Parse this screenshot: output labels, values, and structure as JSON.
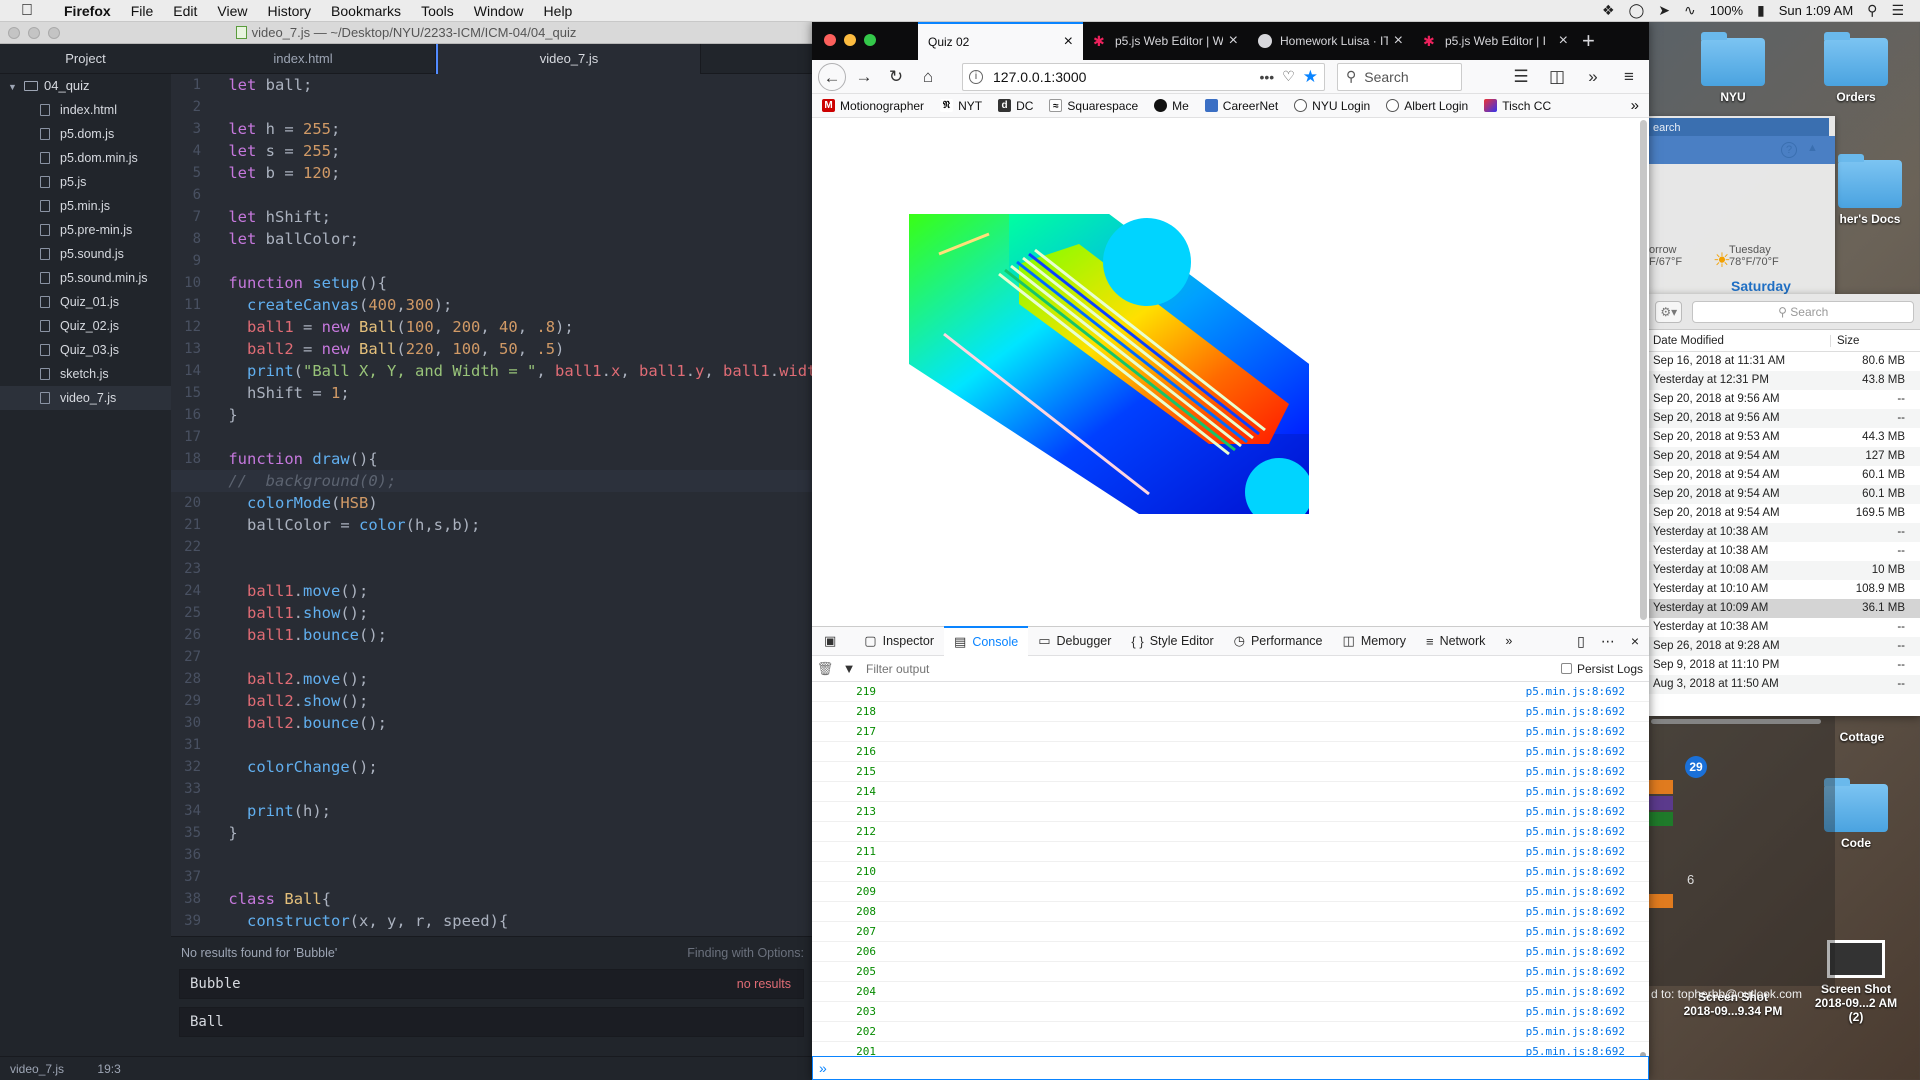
{
  "menubar": {
    "app": "Firefox",
    "items": [
      "File",
      "Edit",
      "View",
      "History",
      "Bookmarks",
      "Tools",
      "Window",
      "Help"
    ],
    "battery": "100%",
    "clock": "Sun 1:09 AM"
  },
  "editor": {
    "title": "video_7.js — ~/Desktop/NYU/2233-ICM/ICM-04/04_quiz",
    "tree_header": "Project",
    "folder": "04_quiz",
    "files": [
      "index.html",
      "p5.dom.js",
      "p5.dom.min.js",
      "p5.js",
      "p5.min.js",
      "p5.pre-min.js",
      "p5.sound.js",
      "p5.sound.min.js",
      "Quiz_01.js",
      "Quiz_02.js",
      "Quiz_03.js",
      "sketch.js",
      "video_7.js"
    ],
    "active_file_index": 12,
    "tabs": [
      "index.html",
      "video_7.js"
    ],
    "active_tab_index": 1,
    "current_line": 19,
    "find": {
      "message": "No results found for 'Bubble'",
      "options": "Finding with Options:",
      "find_value": "Bubble",
      "find_status": "no results",
      "replace_value": "Ball"
    },
    "status": {
      "file": "video_7.js",
      "cursor": "19:3"
    }
  },
  "firefox": {
    "tabs": [
      {
        "title": "Quiz 02",
        "icon": "page-icon"
      },
      {
        "title": "p5.js Web Editor | W",
        "icon": "p5-star-icon"
      },
      {
        "title": "Homework Luisa · IT",
        "icon": "github-icon"
      },
      {
        "title": "p5.js Web Editor | I",
        "icon": "p5-star-icon"
      }
    ],
    "active_tab_index": 0,
    "url": "127.0.0.1:3000",
    "search_placeholder": "Search",
    "bookmarks": [
      "Motionographer",
      "NYT",
      "DC",
      "Squarespace",
      "Me",
      "CareerNet",
      "NYU Login",
      "Albert Login",
      "Tisch CC"
    ],
    "devtools": {
      "tabs": [
        "Inspector",
        "Console",
        "Debugger",
        "Style Editor",
        "Performance",
        "Memory",
        "Network"
      ],
      "active_tab_index": 1,
      "filter_placeholder": "Filter output",
      "persist_logs": "Persist Logs",
      "log_source": "p5.min.js:8:692",
      "console_values": [
        219,
        218,
        217,
        216,
        215,
        214,
        213,
        212,
        211,
        210,
        209,
        208,
        207,
        206,
        205,
        204,
        203,
        202,
        201
      ],
      "prompt": "»"
    }
  },
  "finder": {
    "search_placeholder": "Search",
    "columns": [
      "Date Modified",
      "Size"
    ],
    "rows": [
      {
        "date": "Sep 16, 2018 at 11:31 AM",
        "size": "80.6 MB"
      },
      {
        "date": "Yesterday at 12:31 PM",
        "size": "43.8 MB"
      },
      {
        "date": "Sep 20, 2018 at 9:56 AM",
        "size": "--"
      },
      {
        "date": "Sep 20, 2018 at 9:56 AM",
        "size": "--"
      },
      {
        "date": "Sep 20, 2018 at 9:53 AM",
        "size": "44.3 MB"
      },
      {
        "date": "Sep 20, 2018 at 9:54 AM",
        "size": "127 MB"
      },
      {
        "date": "Sep 20, 2018 at 9:54 AM",
        "size": "60.1 MB"
      },
      {
        "date": "Sep 20, 2018 at 9:54 AM",
        "size": "60.1 MB"
      },
      {
        "date": "Sep 20, 2018 at 9:54 AM",
        "size": "169.5 MB"
      },
      {
        "date": "Yesterday at 10:38 AM",
        "size": "--"
      },
      {
        "date": "Yesterday at 10:38 AM",
        "size": "--"
      },
      {
        "date": "Yesterday at 10:08 AM",
        "size": "10 MB"
      },
      {
        "date": "Yesterday at 10:10 AM",
        "size": "108.9 MB"
      },
      {
        "date": "Yesterday at 10:09 AM",
        "size": "36.1 MB"
      },
      {
        "date": "Yesterday at 10:38 AM",
        "size": "--"
      },
      {
        "date": "Sep 26, 2018 at 9:28 AM",
        "size": "--"
      },
      {
        "date": "Sep 9, 2018 at 11:10 PM",
        "size": "--"
      },
      {
        "date": "Aug 3, 2018 at 11:50 AM",
        "size": "--"
      }
    ],
    "selected_row_index": 13
  },
  "notifications": {
    "search_fragment": "earch",
    "weather_left": [
      "orrow",
      "F/67°F"
    ],
    "weather_right": [
      "Tuesday",
      "78°F/70°F"
    ],
    "weather_day": "Saturday"
  },
  "calendar": {
    "today": "29",
    "next": "6",
    "email": "d to: topherbb@outlook.com",
    "event_colors": [
      "#e07b1f",
      "#5b3a8c",
      "#1f7a2a",
      "#e07b1f"
    ]
  },
  "desktop": {
    "icons": [
      {
        "label": "NYU",
        "kind": "folder"
      },
      {
        "label": "Orders",
        "kind": "folder"
      },
      {
        "label": "her's Docs",
        "kind": "folder"
      },
      {
        "label": "Cottage",
        "kind": "folder"
      },
      {
        "label": "Code",
        "kind": "folder"
      }
    ],
    "screenshots": [
      {
        "label": "Screen Shot",
        "sub": "2018-09...9.34 PM"
      },
      {
        "label": "Screen Shot",
        "sub": "2018-09...2 AM (2)"
      }
    ]
  }
}
